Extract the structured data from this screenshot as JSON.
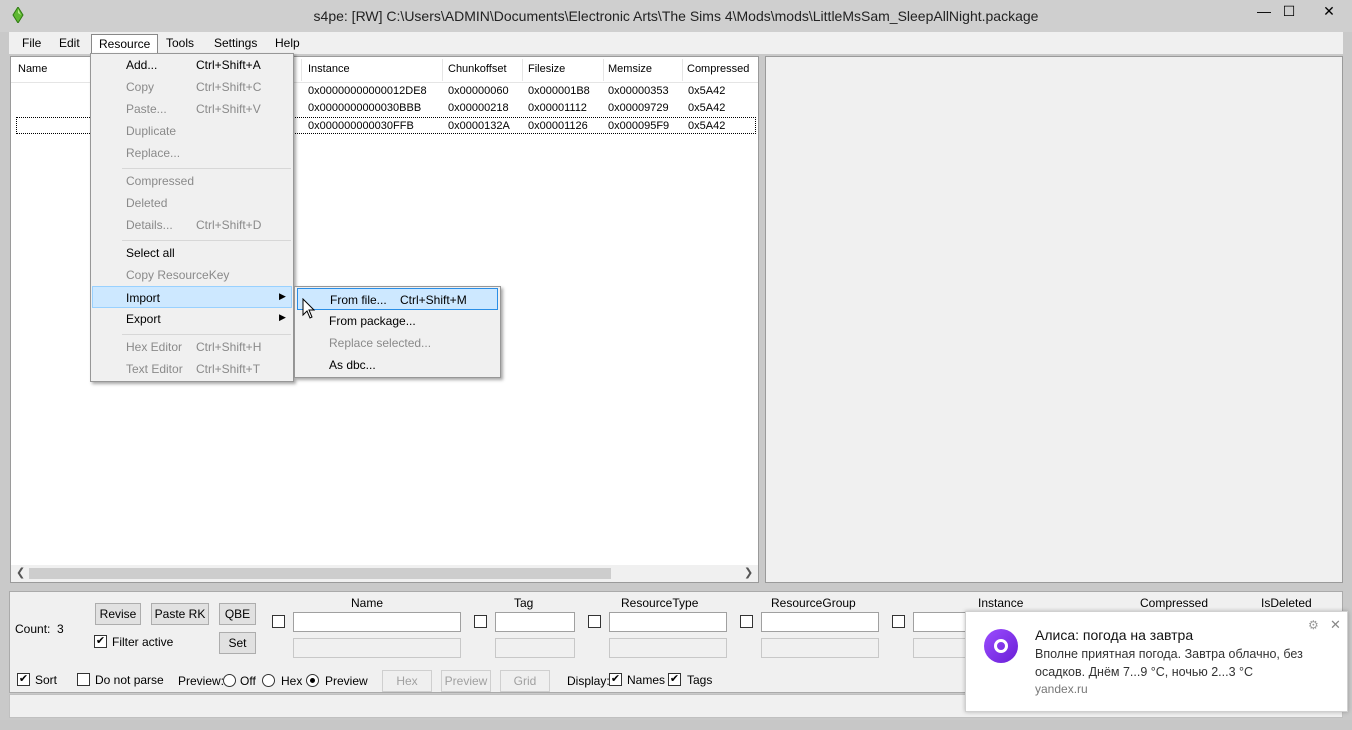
{
  "window": {
    "title": "s4pe: [RW] C:\\Users\\ADMIN\\Documents\\Electronic Arts\\The Sims 4\\Mods\\mods\\LittleMsSam_SleepAllNight.package",
    "minimize": "—",
    "maximize": "☐",
    "close": "✕"
  },
  "menubar": {
    "file": "File",
    "edit": "Edit",
    "resource": "Resource",
    "tools": "Tools",
    "settings": "Settings",
    "help": "Help"
  },
  "grid": {
    "columns": [
      "Name",
      "Instance",
      "Chunkoffset",
      "Filesize",
      "Memsize",
      "Compressed"
    ],
    "rows": [
      [
        "0x00000000000012DE8",
        "0x00000060",
        "0x000001B8",
        "0x00000353",
        "0x5A42"
      ],
      [
        "0x0000000000030BBB",
        "0x00000218",
        "0x00001112",
        "0x00009729",
        "0x5A42"
      ],
      [
        "0x000000000030FFB",
        "0x0000132A",
        "0x00001126",
        "0x000095F9",
        "0x5A42"
      ]
    ]
  },
  "resource_menu": {
    "add": "Add...",
    "add_sc": "Ctrl+Shift+A",
    "copy": "Copy",
    "copy_sc": "Ctrl+Shift+C",
    "paste": "Paste...",
    "paste_sc": "Ctrl+Shift+V",
    "duplicate": "Duplicate",
    "replace": "Replace...",
    "compressed": "Compressed",
    "deleted": "Deleted",
    "details": "Details...",
    "details_sc": "Ctrl+Shift+D",
    "select_all": "Select all",
    "copy_key": "Copy ResourceKey",
    "import": "Import",
    "export": "Export",
    "hex_editor": "Hex Editor",
    "hex_sc": "Ctrl+Shift+H",
    "text_editor": "Text Editor",
    "text_sc": "Ctrl+Shift+T"
  },
  "import_menu": {
    "from_file": "From file...",
    "from_file_sc": "Ctrl+Shift+M",
    "from_package": "From package...",
    "replace_selected": "Replace selected...",
    "as_dbc": "As dbc..."
  },
  "bottom": {
    "count_label": "Count:",
    "count_value": "3",
    "revise": "Revise",
    "paste_rk": "Paste RK",
    "qbe": "QBE",
    "set": "Set",
    "filter_active": "Filter active",
    "sort": "Sort",
    "do_not_parse": "Do not parse",
    "preview_label": "Preview:",
    "off": "Off",
    "hex": "Hex",
    "preview": "Preview",
    "btn_hex": "Hex",
    "btn_preview": "Preview",
    "btn_grid": "Grid",
    "display_label": "Display:",
    "names": "Names",
    "tags": "Tags",
    "filter_headers": {
      "name": "Name",
      "tag": "Tag",
      "resource_type": "ResourceType",
      "resource_group": "ResourceGroup",
      "instance": "Instance",
      "compressed": "Compressed",
      "is_deleted": "IsDeleted"
    }
  },
  "notification": {
    "title": "Алиса: погода на завтра",
    "body": "Вполне приятная погода. Завтра облачно, без осадков. Днём 7...9 °C, ночью 2...3 °C",
    "source": "yandex.ru",
    "gear": "⚙",
    "close": "✕"
  },
  "colors": {
    "highlight": "#cde8ff",
    "highlight_border": "#2a8ee6",
    "alice": "#8a3ffc"
  }
}
